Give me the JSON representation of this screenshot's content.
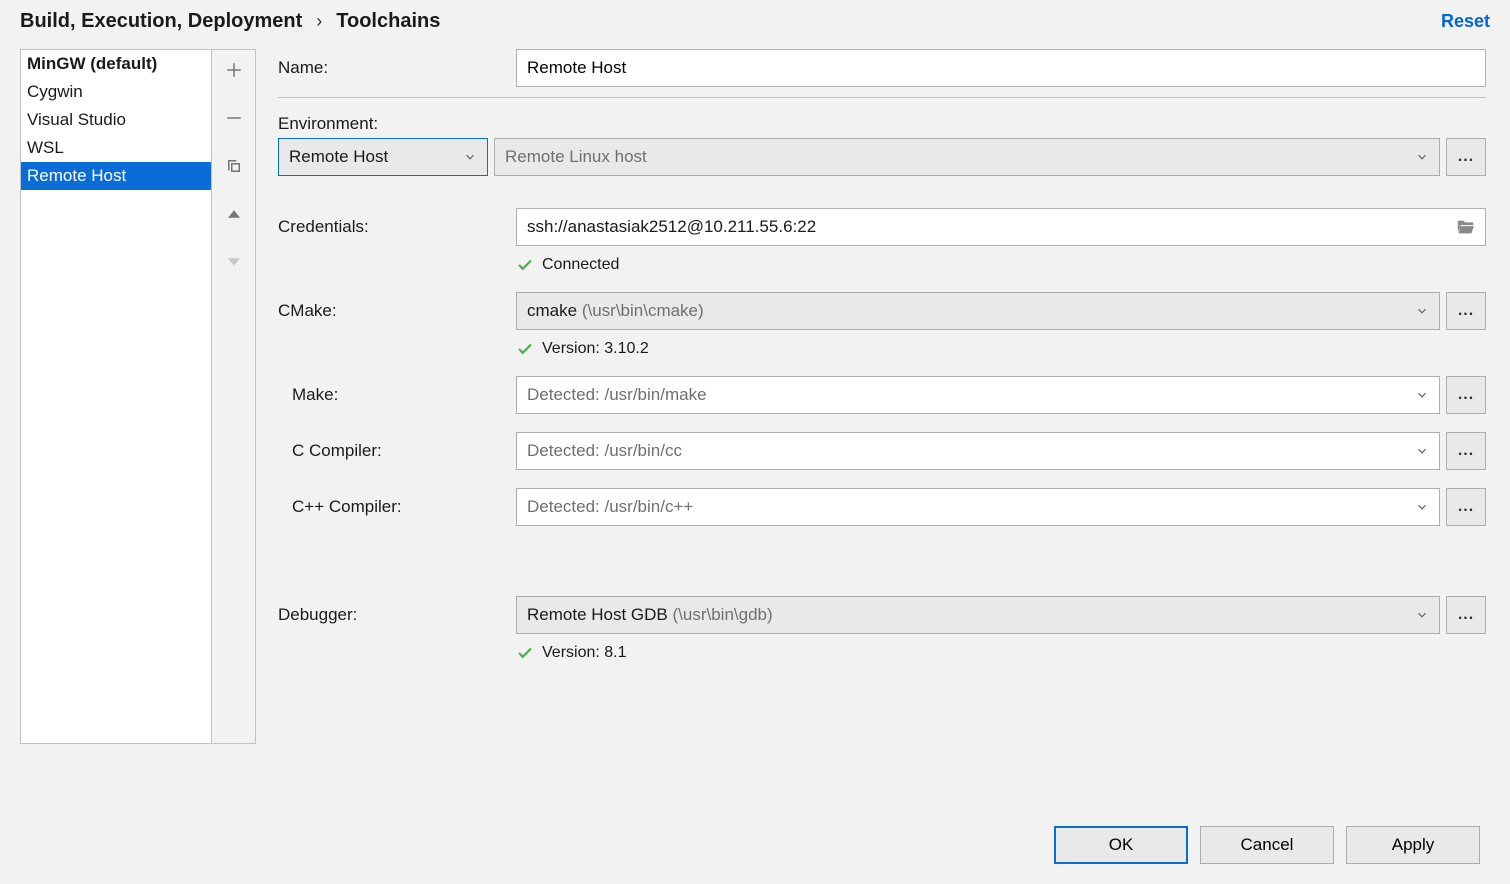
{
  "breadcrumb": {
    "parent": "Build, Execution, Deployment",
    "current": "Toolchains"
  },
  "reset_label": "Reset",
  "toolchains": {
    "items": [
      {
        "label": "MinGW (default)",
        "default": true,
        "selected": false
      },
      {
        "label": "Cygwin",
        "default": false,
        "selected": false
      },
      {
        "label": "Visual Studio",
        "default": false,
        "selected": false
      },
      {
        "label": "WSL",
        "default": false,
        "selected": false
      },
      {
        "label": "Remote Host",
        "default": false,
        "selected": true
      }
    ]
  },
  "form": {
    "name_label": "Name:",
    "name_value": "Remote Host",
    "environment_label": "Environment:",
    "environment_type": "Remote Host",
    "environment_placeholder": "Remote Linux host",
    "credentials_label": "Credentials:",
    "credentials_value": "ssh://anastasiak2512@10.211.55.6:22",
    "credentials_status": "Connected",
    "cmake_label": "CMake:",
    "cmake_primary": "cmake",
    "cmake_secondary": "(\\usr\\bin\\cmake)",
    "cmake_status": "Version: 3.10.2",
    "make_label": "Make:",
    "make_placeholder": "Detected: /usr/bin/make",
    "c_compiler_label": "C Compiler:",
    "c_compiler_placeholder": "Detected: /usr/bin/cc",
    "cpp_compiler_label": "C++ Compiler:",
    "cpp_compiler_placeholder": "Detected: /usr/bin/c++",
    "debugger_label": "Debugger:",
    "debugger_primary": "Remote Host GDB",
    "debugger_secondary": "(\\usr\\bin\\gdb)",
    "debugger_status": "Version: 8.1"
  },
  "footer": {
    "ok": "OK",
    "cancel": "Cancel",
    "apply": "Apply"
  }
}
